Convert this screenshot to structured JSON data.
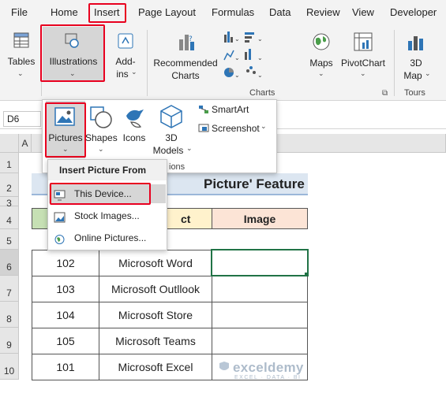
{
  "tabs": [
    "File",
    "Home",
    "Insert",
    "Page Layout",
    "Formulas",
    "Data",
    "Review",
    "View",
    "Developer"
  ],
  "ribbon": {
    "tables": "Tables",
    "illustrations": "Illustrations",
    "addins_line1": "Add-",
    "addins_line2": "ins",
    "recommended_line1": "Recommended",
    "recommended_line2": "Charts",
    "maps": "Maps",
    "pivotchart": "PivotChart",
    "map3d_line1": "3D",
    "map3d_line2": "Map",
    "charts_group": "Charts",
    "tours_group": "Tours"
  },
  "illustrations_panel": {
    "pictures": "Pictures",
    "shapes": "Shapes",
    "icons": "Icons",
    "models_line1": "3D",
    "models_line2": "Models",
    "smartart": "SmartArt",
    "screenshot": "Screenshot",
    "group_label_partial": "ions"
  },
  "insert_picture_menu": {
    "header": "Insert Picture From",
    "items": [
      "This Device...",
      "Stock Images...",
      "Online Pictures..."
    ]
  },
  "name_box": "D6",
  "column_headers": [
    "A"
  ],
  "row_headers": [
    "1",
    "2",
    "3",
    "4",
    "5",
    "6",
    "7",
    "8",
    "9",
    "10"
  ],
  "sheet": {
    "title_partial": "Picture' Feature",
    "col_header_partial": "ct",
    "col_image": "Image",
    "rows": [
      {
        "id": "102",
        "product": "Microsoft Word"
      },
      {
        "id": "103",
        "product": "Microsoft Outllook"
      },
      {
        "id": "104",
        "product": "Microsoft Store"
      },
      {
        "id": "105",
        "product": "Microsoft Teams"
      },
      {
        "id": "101",
        "product": "Microsoft Excel"
      }
    ]
  },
  "watermark": {
    "brand": "exceldemy",
    "tagline": "EXCEL · DATA · BI"
  },
  "colors": {
    "highlight_red": "#e8001f",
    "header_green": "#c6e0b4",
    "header_yellow": "#fff2cc",
    "header_peach": "#fce4d6",
    "title_band": "#dce6f1",
    "selection_green": "#217346"
  }
}
